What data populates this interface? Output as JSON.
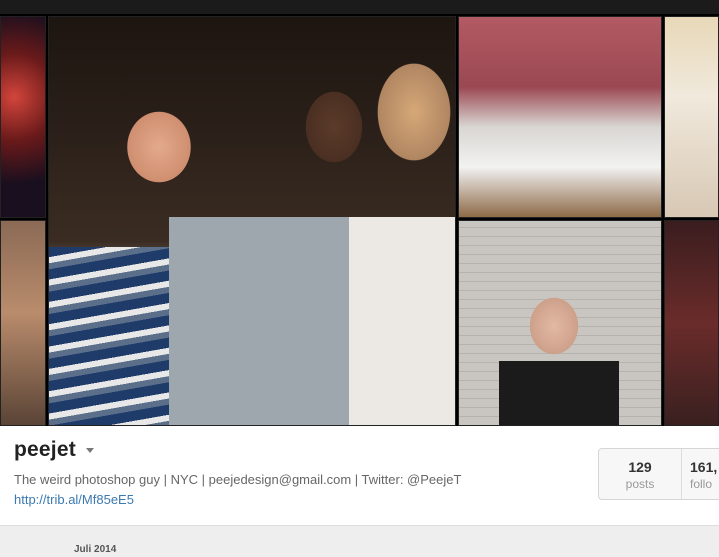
{
  "profile": {
    "username": "peejet",
    "bio": "The weird photoshop guy | NYC | peejedesign@gmail.com | Twitter: @PeejeT",
    "link": "http://trib.al/Mf85eE5"
  },
  "stats": {
    "posts": {
      "count": "129",
      "label": "posts"
    },
    "followers": {
      "count": "161,",
      "label": "follo"
    }
  },
  "timeline": {
    "month": "Juli 2014"
  },
  "icons": {
    "dropdown": "chevron-down-icon"
  }
}
